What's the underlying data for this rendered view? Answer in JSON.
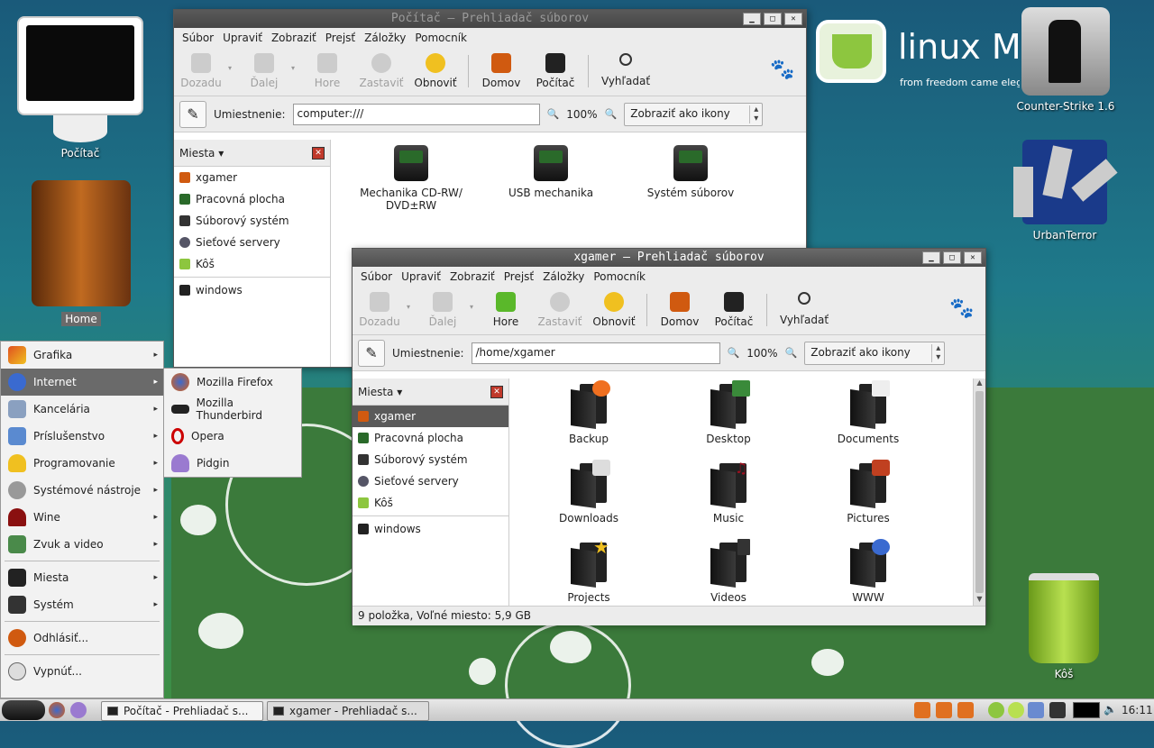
{
  "desktop": {
    "icons": [
      {
        "label": "Počítač"
      },
      {
        "label": "Home"
      },
      {
        "label": "Counter-Strike 1.6"
      },
      {
        "label": "UrbanTerror"
      },
      {
        "label": "Kôš"
      }
    ],
    "logo_text": "linux Mi",
    "logo_tagline": "from freedom came eleg"
  },
  "window_computer": {
    "title": "Počítač – Prehliadač súborov",
    "menu": [
      "Súbor",
      "Upraviť",
      "Zobraziť",
      "Prejsť",
      "Záložky",
      "Pomocník"
    ],
    "toolbar": [
      "Dozadu",
      "Ďalej",
      "Hore",
      "Zastaviť",
      "Obnoviť",
      "Domov",
      "Počítač",
      "Vyhľadať"
    ],
    "location_label": "Umiestnenie:",
    "location_value": "computer:///",
    "zoom": "100%",
    "view_mode": "Zobraziť ako ikony",
    "sidebar_title": "Miesta",
    "sidebar_items": [
      "xgamer",
      "Pracovná plocha",
      "Súborový systém",
      "Sieťové servery",
      "Kôš",
      "windows"
    ],
    "items": [
      "Mechanika CD-RW/\nDVD±RW",
      "USB mechanika",
      "Systém súborov"
    ]
  },
  "window_home": {
    "title": "xgamer – Prehliadač súborov",
    "menu": [
      "Súbor",
      "Upraviť",
      "Zobraziť",
      "Prejsť",
      "Záložky",
      "Pomocník"
    ],
    "toolbar": [
      "Dozadu",
      "Ďalej",
      "Hore",
      "Zastaviť",
      "Obnoviť",
      "Domov",
      "Počítač",
      "Vyhľadať"
    ],
    "location_label": "Umiestnenie:",
    "location_value": "/home/xgamer",
    "zoom": "100%",
    "view_mode": "Zobraziť ako ikony",
    "sidebar_title": "Miesta",
    "sidebar_items": [
      "xgamer",
      "Pracovná plocha",
      "Súborový systém",
      "Sieťové servery",
      "Kôš",
      "windows"
    ],
    "folders": [
      "Backup",
      "Desktop",
      "Documents",
      "Downloads",
      "Music",
      "Pictures",
      "Projects",
      "Videos",
      "WWW"
    ],
    "status": "9 položka, Voľné miesto: 5,9 GB"
  },
  "start_menu": {
    "items": [
      "Grafika",
      "Internet",
      "Kancelária",
      "Príslušenstvo",
      "Programovanie",
      "Systémové nástroje",
      "Wine",
      "Zvuk a video",
      "Miesta",
      "Systém",
      "Odhlásiť...",
      "Vypnúť..."
    ]
  },
  "internet_submenu": {
    "items": [
      "Mozilla Firefox",
      "Mozilla Thunderbird",
      "Opera",
      "Pidgin"
    ]
  },
  "taskbar": {
    "tasks": [
      "Počítač - Prehliadač s...",
      "xgamer - Prehliadač s..."
    ],
    "clock": "16:11"
  },
  "colors": {
    "accent_green": "#8dc63f",
    "selection": "#5a5a5a"
  }
}
